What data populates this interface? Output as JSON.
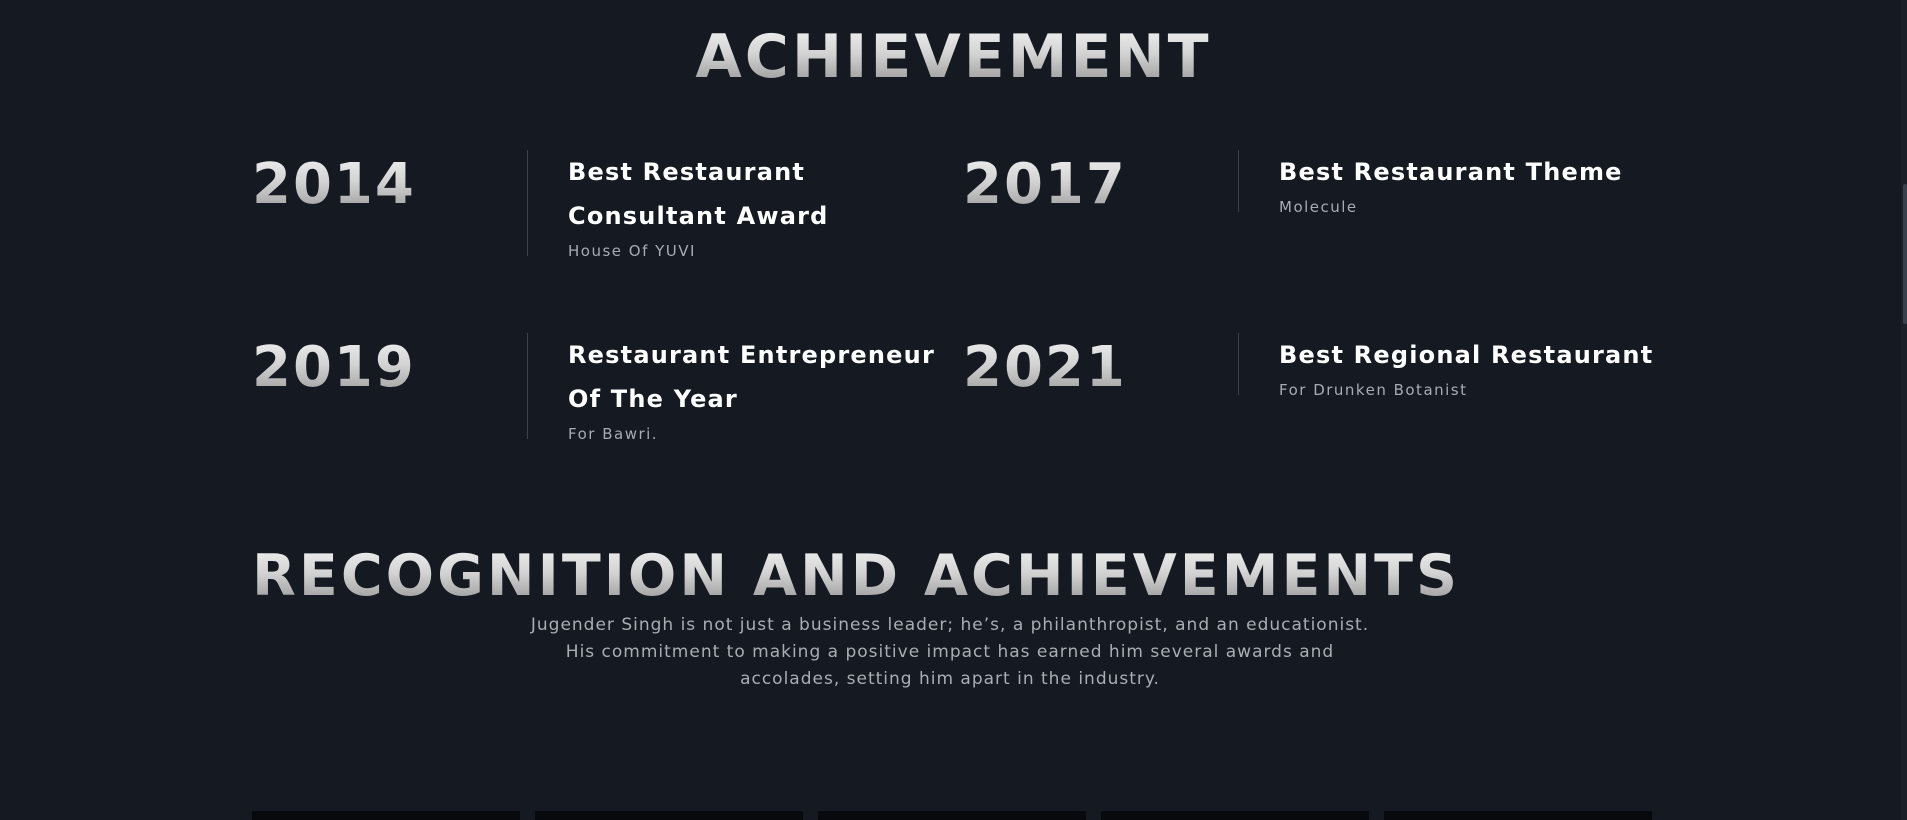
{
  "top_heading": "ACHIEVEMENT",
  "achievements": [
    {
      "year": "2014",
      "title": "Best Restaurant Consultant Award",
      "subtitle": "House Of YUVI"
    },
    {
      "year": "2017",
      "title": "Best Restaurant Theme",
      "subtitle": "Molecule"
    },
    {
      "year": "2019",
      "title": "Restaurant Entrepreneur Of The Year",
      "subtitle": "For Bawri."
    },
    {
      "year": "2021",
      "title": "Best Regional Restaurant",
      "subtitle": "For Drunken Botanist"
    }
  ],
  "recognition": {
    "heading": "RECOGNITION AND ACHIEVEMENTS",
    "description": "Jugender Singh is not just a business leader; he’s, a philanthropist, and an educationist. His commitment to making a positive impact has earned him several awards and accolades, setting him apart in the industry."
  },
  "colors": {
    "background": "#151921",
    "card": "#07090c",
    "divider": "#3d434e",
    "muted_text": "#a7abb3"
  }
}
